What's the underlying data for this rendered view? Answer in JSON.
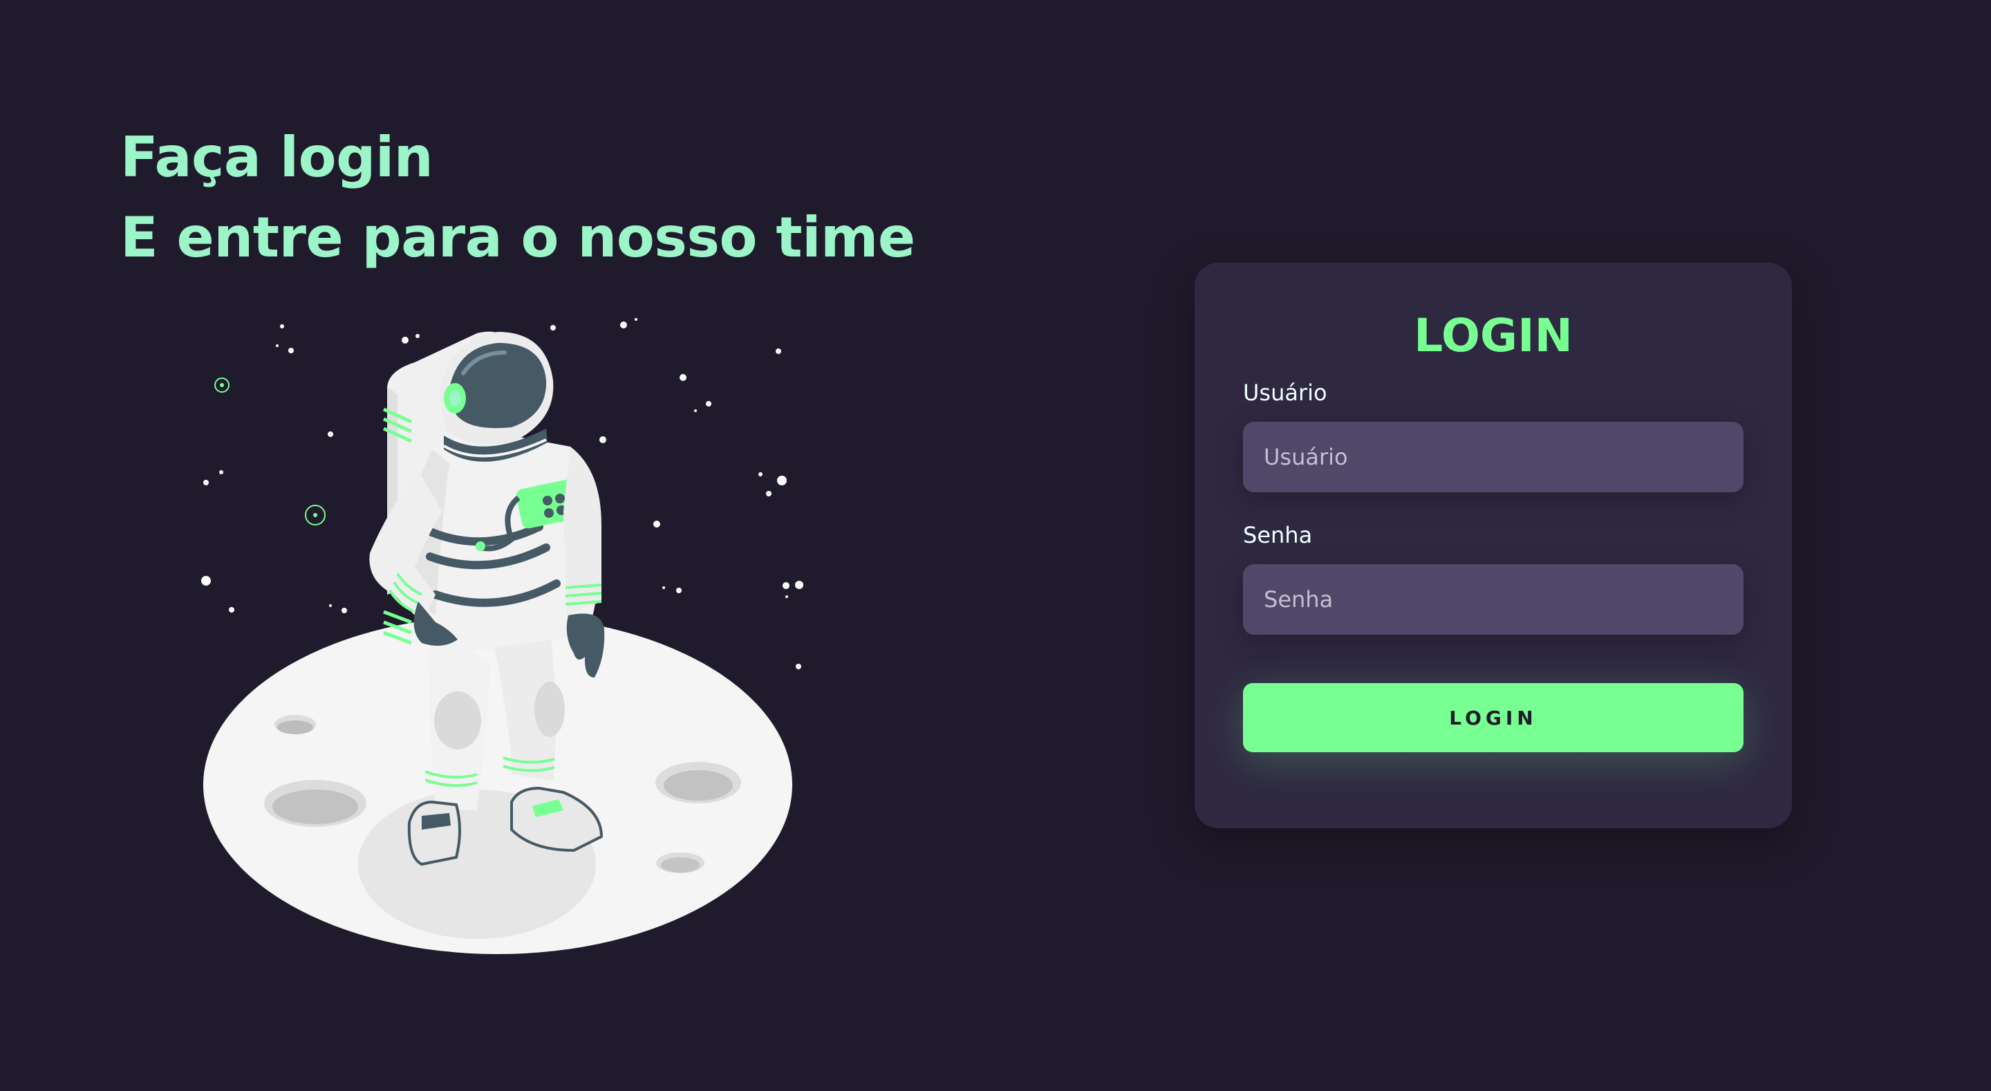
{
  "hero": {
    "line1": "Faça login",
    "line2": "E entre para o nosso time"
  },
  "illustration": {
    "subject": "astronaut-on-moon",
    "colors": {
      "accent": "#77ff92",
      "moon": "#f5f5f5",
      "suit": "#ececec",
      "dark": "#455a64"
    }
  },
  "login_card": {
    "title": "LOGIN",
    "username": {
      "label": "Usuário",
      "placeholder": "Usuário",
      "value": ""
    },
    "password": {
      "label": "Senha",
      "placeholder": "Senha",
      "value": ""
    },
    "submit_label": "LOGIN"
  },
  "theme": {
    "background": "#201b2c",
    "card": "#2f2841",
    "input": "#514869",
    "heading": "#9cf5c8",
    "accent": "#77ff92",
    "text": "#f0ffff"
  }
}
